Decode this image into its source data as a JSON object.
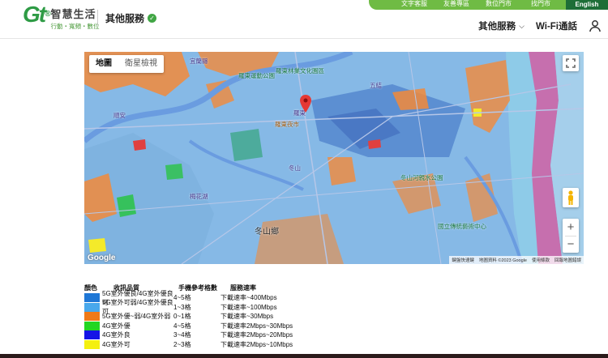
{
  "topbar": {
    "links": [
      "文字客服",
      "友善專區",
      "數位門市",
      "找門市"
    ],
    "lang": "English"
  },
  "logo": {
    "mark": "Gt",
    "name": "智慧生活",
    "slogan": "行動・寬頻・數位"
  },
  "header": {
    "service_title": "其他服務",
    "nav": [
      {
        "label": "其他服務",
        "has_dropdown": true
      },
      {
        "label": "Wi-Fi通話",
        "has_dropdown": false
      }
    ]
  },
  "map": {
    "tabs": [
      "地圖",
      "衛星檢視"
    ],
    "active_tab": "地圖",
    "labels": [
      {
        "text": "冬山鄉",
        "kind": "big"
      },
      {
        "text": "冬山",
        "kind": "normal"
      },
      {
        "text": "五結",
        "kind": "normal"
      },
      {
        "text": "羅東",
        "kind": "normal"
      },
      {
        "text": "羅東運動公園",
        "kind": "green"
      },
      {
        "text": "羅東林業文化園區",
        "kind": "green"
      },
      {
        "text": "冬山河親水公園",
        "kind": "green"
      },
      {
        "text": "羅東夜市",
        "kind": "orange"
      },
      {
        "text": "國立傳統藝術中心",
        "kind": "green"
      },
      {
        "text": "宜蘭縣",
        "kind": "normal"
      },
      {
        "text": "梅花湖",
        "kind": "normal"
      },
      {
        "text": "順安",
        "kind": "normal"
      }
    ],
    "google": "Google",
    "attribution": [
      "鍵盤快速鍵",
      "地圖資料 ©2023 Google",
      "使用條款",
      "回報地圖錯誤"
    ],
    "zoom_in": "+",
    "zoom_out": "−"
  },
  "legend": {
    "headers": [
      "顏色",
      "收訊品質",
      "手機參考格數",
      "服務速率"
    ],
    "rows": [
      {
        "color": "#1f77d6",
        "quality": "5G室外優良/4G室外優良可",
        "bars": "4~5格",
        "speed": "下載速率~400Mbps"
      },
      {
        "color": "#48a8ec",
        "quality": "5G室外可弱/4G室外優良可",
        "bars": "1~3格",
        "speed": "下載速率~100Mbps"
      },
      {
        "color": "#f07a18",
        "quality": "5G室外優~弱/4G室外弱",
        "bars": "0~1格",
        "speed": "下載速率~30Mbps"
      },
      {
        "color": "#22d622",
        "quality": "4G室外優",
        "bars": "4~5格",
        "speed": "下載速率2Mbps~30Mbps"
      },
      {
        "color": "#1414e6",
        "quality": "4G室外良",
        "bars": "3~4格",
        "speed": "下載速率2Mbps~20Mbps"
      },
      {
        "color": "#f4f010",
        "quality": "4G室外可",
        "bars": "2~3格",
        "speed": "下載速率2Mbps~10Mbps"
      }
    ]
  }
}
